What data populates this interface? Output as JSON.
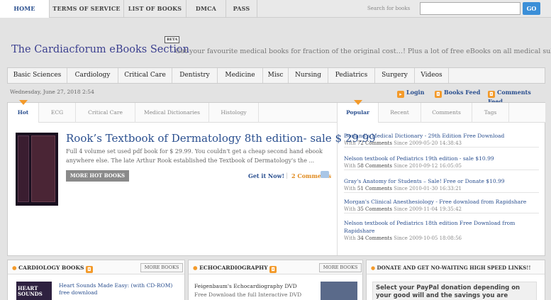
{
  "top_nav": {
    "items": [
      "HOME",
      "TERMS OF SERVICE",
      "LIST OF BOOKS",
      "DMCA",
      "PASS"
    ],
    "active": "HOME",
    "search_label": "Search for books",
    "go_label": "GO"
  },
  "site": {
    "title": "The Cardiacforum eBooks Section",
    "beta": "BETA",
    "tagline": "Get your favourite medical books for fraction of the original cost…! Plus a lot of free eBooks on all medical subjects."
  },
  "categories": [
    "Basic Sciences",
    "Cardiology",
    "Critical Care",
    "Dentistry",
    "Medicine",
    "Misc",
    "Nursing",
    "Pediatrics",
    "Surgery",
    "Videos"
  ],
  "info_bar": {
    "date": "Wednesday, June 27, 2018 2:54",
    "login": "Login",
    "books_feed": "Books Feed",
    "comments_feed": "Comments Feed"
  },
  "left_tabs": [
    "Hot",
    "ECG",
    "Critical Care",
    "Medical Dictionaries",
    "Histology"
  ],
  "right_tabs": [
    "Popular",
    "Recent",
    "Comments",
    "Tags"
  ],
  "featured": {
    "title": "Rook’s Textbook of Dermatology 8th edition- sale $ 29.99",
    "description": "Full 4 volume set used pdf book for $ 29.99. You couldn't get a cheap second hand ebook anywhere else. The late Arthur Rook established the Textbook of Dermatology's the ...",
    "more_button": "MORE HOT BOOKS",
    "get_it": "Get it Now!",
    "separator": "|",
    "comments": "2 Comments"
  },
  "popular": [
    {
      "title": "Dorland's Medical Dictionary - 29th Edition Free Download",
      "with": "With",
      "count": "72 Comments",
      "since": "Since 2009-05-20 14:38:43"
    },
    {
      "title": "Nelson textbook of Pediatrics 19th edition - sale $10.99",
      "with": "With",
      "count": "58 Comments",
      "since": "Since 2010-09-12 16:05:05"
    },
    {
      "title": "Gray's Anatomy for Students – Sale! Free or Donate $10.99",
      "with": "With",
      "count": "51 Comments",
      "since": "Since 2010-01-30 16:33:21"
    },
    {
      "title": "Morgan's Clinical Anesthesiology - Free download from Rapidshare",
      "with": "With",
      "count": "35 Comments",
      "since": "Since 2009-11-04 19:35:42"
    },
    {
      "title": "Nelson textbook of Pediatrics 18th edition Free Download from Rapidshare",
      "with": "With",
      "count": "34 Comments",
      "since": "Since 2009-10-05 18:08:56"
    }
  ],
  "bottom": {
    "cardiology": {
      "title": "CARDIOLOGY BOOKS",
      "more": "MORE BOOKS",
      "book_title": "Heart Sounds Made Easy: (with CD-ROM) free download",
      "cover_text": "HEART SOUNDS"
    },
    "echo": {
      "title": "ECHOCARDIOGRAPHY",
      "more": "MORE BOOKS",
      "book_title": "Feigenbaum's Echocardiography DVD",
      "desc": "Free Download the full Interactive DVD"
    },
    "donate": {
      "title": "DONATE AND GET NO-WAITING HIGH SPEED LINKS!!",
      "text": "Select your PayPal donation depending on your good will and the savings you are"
    }
  },
  "colors": {
    "link": "#2a4f8f",
    "accent": "#f39a2a",
    "go": "#3b8fd8"
  }
}
